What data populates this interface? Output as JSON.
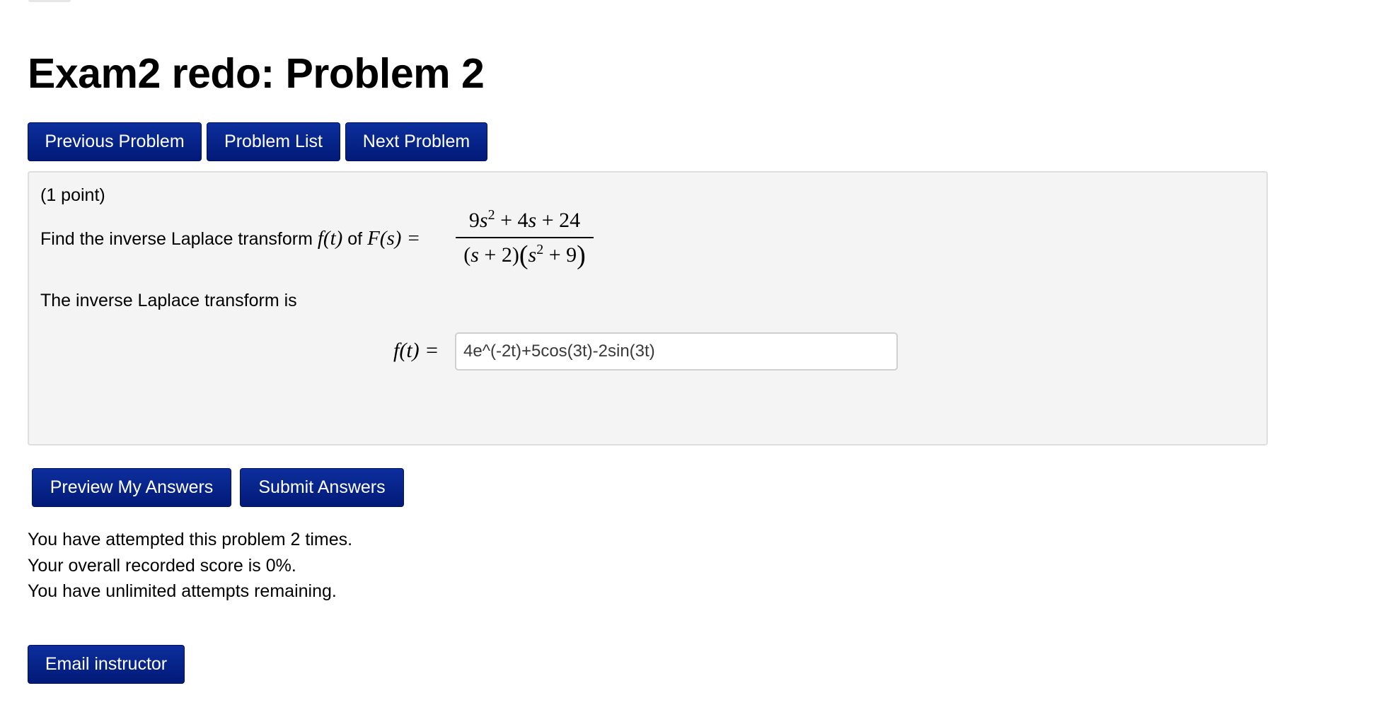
{
  "page": {
    "title": "Exam2 redo: Problem 2"
  },
  "nav": {
    "previous_label": "Previous Problem",
    "list_label": "Problem List",
    "next_label": "Next Problem"
  },
  "problem": {
    "points": "(1 point)",
    "prompt_text": "Find the inverse Laplace transform",
    "function_name": "f(t)",
    "of_text": "of",
    "transform_lhs": "F(s) =",
    "numerator": "9s² + 4s + 24",
    "denominator": "(s + 2)(s² + 9)",
    "answer_intro": "The inverse Laplace transform is",
    "answer_label": "f(t) =",
    "answer_value": "4e^(-2t)+5cos(3t)-2sin(3t)"
  },
  "actions": {
    "preview_label": "Preview My Answers",
    "submit_label": "Submit Answers"
  },
  "status": {
    "attempts": "You have attempted this problem 2 times.",
    "score": "Your overall recorded score is 0%.",
    "remaining": "You have unlimited attempts remaining."
  },
  "footer": {
    "email_label": "Email instructor"
  },
  "colors": {
    "button_bg": "#0c2e9c",
    "button_text": "#ffffff",
    "problem_bg": "#f4f4f4",
    "problem_border": "#dedede"
  }
}
